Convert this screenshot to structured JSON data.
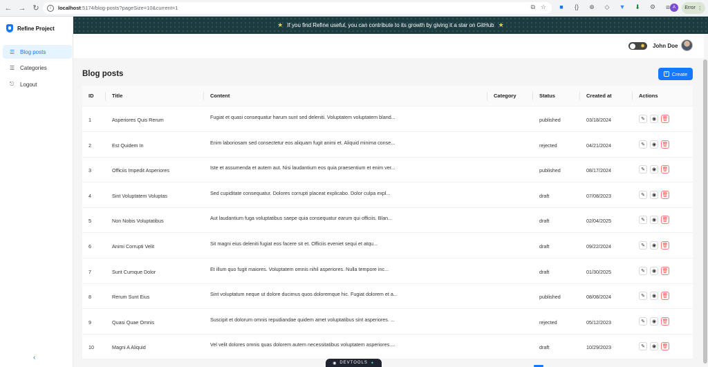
{
  "browser": {
    "url_host": "localhost",
    "url_rest": ":5174/blog-posts?pageSize=10&current=1",
    "profile_initial": "A",
    "error_label": "Error"
  },
  "sidebar": {
    "brand": "Refine Project",
    "items": [
      {
        "label": "Blog posts",
        "icon": "list-icon"
      },
      {
        "label": "Categories",
        "icon": "list-icon"
      },
      {
        "label": "Logout",
        "icon": "logout-icon"
      }
    ],
    "collapse_glyph": "‹"
  },
  "banner": {
    "text": "If you find Refine useful, you can contribute to its growth by giving it a star on GitHub"
  },
  "header": {
    "user_name": "John Doe"
  },
  "page": {
    "title": "Blog posts",
    "create_label": "Create"
  },
  "table": {
    "columns": [
      "ID",
      "Title",
      "Content",
      "Category",
      "Status",
      "Created at",
      "Actions"
    ],
    "rows": [
      {
        "id": "1",
        "title": "Asperiores Quis Rerum",
        "content": "Fugiat et quasi consequatur harum sunt sed deleniti. Voluptatem voluptatem bland...",
        "category": "",
        "status": "published",
        "created": "03/18/2024"
      },
      {
        "id": "2",
        "title": "Est Quidem In",
        "content": "Enim laboriosam sed consectetur eos aliquam fugit animi et. Aliquid minima conse...",
        "category": "",
        "status": "rejected",
        "created": "04/21/2024"
      },
      {
        "id": "3",
        "title": "Officiis Impedit Asperiores",
        "content": "Iste et assumenda et autem aut. Nisi laudantium eos quia praesentium et enim ver...",
        "category": "",
        "status": "published",
        "created": "08/17/2024"
      },
      {
        "id": "4",
        "title": "Sint Voluptatem Voluptas",
        "content": "Sed cupiditate consequatur. Dolores corrupti placeat explicabo. Dolor culpa expl...",
        "category": "",
        "status": "draft",
        "created": "07/08/2023"
      },
      {
        "id": "5",
        "title": "Non Nobis Voluptatibus",
        "content": "Aut laudantium fuga voluptatibus saepe quia consequatur earum qui officiis. Blan...",
        "category": "",
        "status": "draft",
        "created": "02/04/2025"
      },
      {
        "id": "6",
        "title": "Animi Corrupti Velit",
        "content": "Sit magni eius deleniti fugiat eos facere sit et. Officiis eveniet sequi et atqu...",
        "category": "",
        "status": "draft",
        "created": "09/22/2024"
      },
      {
        "id": "7",
        "title": "Sunt Cumque Dolor",
        "content": "Et illum quo fugit maiores. Voluptatem omnis nihil asperiores. Nulla tempore inc...",
        "category": "",
        "status": "draft",
        "created": "01/30/2025"
      },
      {
        "id": "8",
        "title": "Rerum Sunt Eius",
        "content": "Sint voluptatum neque ut dolore ducimus quos doloremque hic. Fugiat dolorem et a...",
        "category": "",
        "status": "published",
        "created": "08/08/2024"
      },
      {
        "id": "9",
        "title": "Quasi Quae Omnis",
        "content": "Suscipit et dolorum omnis repudiandae quidem amet voluptatibus sint asperiores. ...",
        "category": "",
        "status": "rejected",
        "created": "05/12/2023"
      },
      {
        "id": "10",
        "title": "Magni A Aliquid",
        "content": "Vel velit dolores omnis quas dolorem autem necessitatibus voluptatem asperiores....",
        "category": "",
        "status": "draft",
        "created": "10/29/2023"
      }
    ]
  },
  "devtools": {
    "label": "DEVTOOLS"
  },
  "colors": {
    "primary": "#1677ff",
    "danger": "#ff4d4f",
    "banner_bg": "#1d3a3f"
  }
}
